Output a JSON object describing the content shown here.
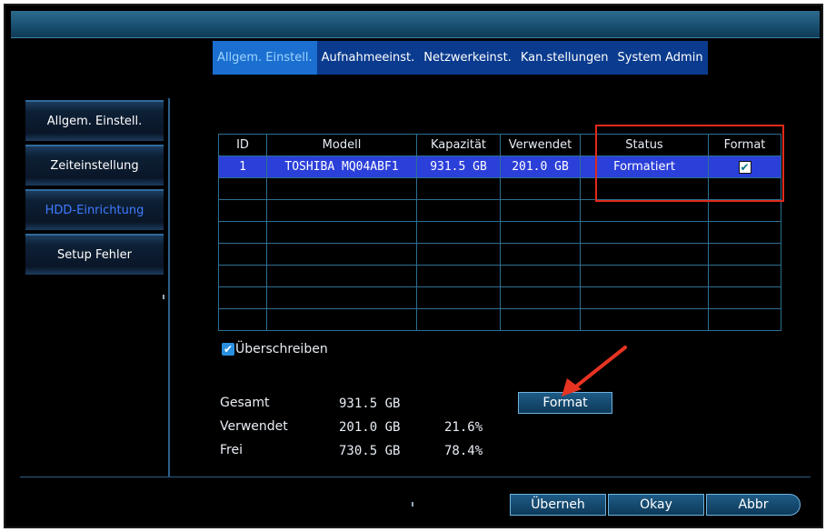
{
  "top_tabs": [
    {
      "label": "Allgem. Einstell."
    },
    {
      "label": "Aufnahmeeinst."
    },
    {
      "label": "Netzwerkeinst."
    },
    {
      "label": "Kan.stellungen"
    },
    {
      "label": "System Admin"
    }
  ],
  "sidebar": {
    "items": [
      {
        "label": "Allgem. Einstell."
      },
      {
        "label": "Zeiteinstellung"
      },
      {
        "label": "HDD-Einrichtung"
      },
      {
        "label": "Setup Fehler"
      }
    ]
  },
  "table": {
    "headers": [
      "ID",
      "Modell",
      "Kapazität",
      "Verwendet",
      "Status",
      "Format"
    ],
    "rows": [
      {
        "id": "1",
        "model": "TOSHIBA MQ04ABF1",
        "capacity": "931.5 GB",
        "used": "201.0 GB",
        "status": "Formatiert",
        "format_checked": true
      }
    ]
  },
  "overwrite": {
    "label": "Überschreiben",
    "checked": true
  },
  "stats": {
    "total_label": "Gesamt",
    "total_value": "931.5 GB",
    "used_label": "Verwendet",
    "used_value": "201.0 GB",
    "used_pct": "21.6%",
    "free_label": "Frei",
    "free_value": "730.5 GB",
    "free_pct": "78.4%"
  },
  "format_button": "Format",
  "footer": {
    "apply": "Überneh",
    "okay": "Okay",
    "cancel": "Abbr"
  },
  "colors": {
    "highlight_box": "#e02a1a",
    "selected_row": "#2b3fd9",
    "accent_tab": "#1a6fd0"
  }
}
